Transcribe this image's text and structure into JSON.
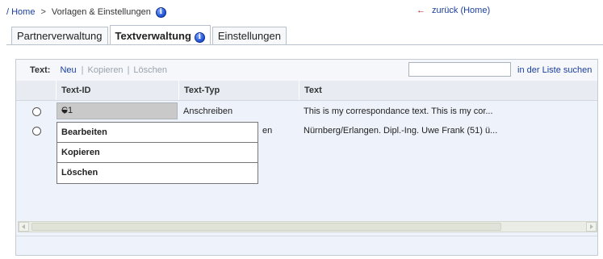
{
  "breadcrumb": {
    "home": "/ Home",
    "separator": ">",
    "current": "Vorlagen & Einstellungen"
  },
  "back_link": "zurück  (Home)",
  "tabs": [
    {
      "label": "Partnerverwaltung",
      "active": false
    },
    {
      "label": "Textverwaltung",
      "active": true
    },
    {
      "label": "Einstellungen",
      "active": false
    }
  ],
  "toolbar": {
    "label": "Text:",
    "new": "Neu",
    "copy": "Kopieren",
    "delete": "Löschen",
    "separator": "|",
    "search_value": "",
    "search_link": "in der Liste suchen"
  },
  "table": {
    "columns": [
      "Text-ID",
      "Text-Typ",
      "Text"
    ],
    "rows": [
      {
        "id": "C1",
        "type": "Anschreiben",
        "text": "This is my correspondance text. This is my cor..."
      },
      {
        "id": "",
        "type": "en",
        "text": "Nürnberg/Erlangen. Dipl.-Ing. Uwe Frank (51) ü..."
      }
    ]
  },
  "menu": {
    "items": [
      "Bearbeiten",
      "Kopieren",
      "Löschen"
    ]
  },
  "icons": {
    "info": "info-icon",
    "back": "left-arrow-icon",
    "combo": "chevron-down-icon"
  },
  "colors": {
    "link": "#1a3e9e",
    "info": "#1d4fd1",
    "back_arrow": "#b01818",
    "panel_bg": "#eef2fa"
  }
}
